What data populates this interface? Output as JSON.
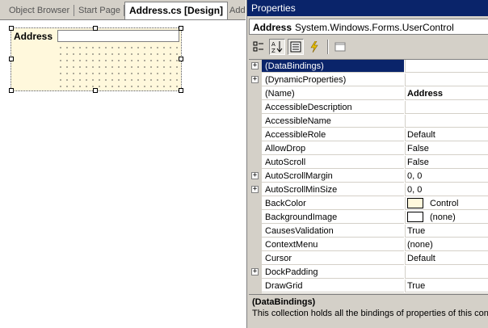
{
  "tabs": [
    {
      "label": "Object Browser"
    },
    {
      "label": "Start Page"
    },
    {
      "label": "Address.cs [Design]",
      "selected": true
    },
    {
      "label": "Addr"
    }
  ],
  "designer": {
    "control_label": "Address",
    "back_color": "#fff8dc"
  },
  "properties": {
    "title": "Properties",
    "object_name": "Address",
    "object_type": "System.Windows.Forms.UserControl",
    "rows": [
      {
        "name": "(DataBindings)",
        "value": "",
        "expandable": true,
        "selected": true
      },
      {
        "name": "(DynamicProperties)",
        "value": "",
        "expandable": true
      },
      {
        "name": "(Name)",
        "value": "Address",
        "bold": true
      },
      {
        "name": "AccessibleDescription",
        "value": ""
      },
      {
        "name": "AccessibleName",
        "value": ""
      },
      {
        "name": "AccessibleRole",
        "value": "Default"
      },
      {
        "name": "AllowDrop",
        "value": "False"
      },
      {
        "name": "AutoScroll",
        "value": "False"
      },
      {
        "name": "AutoScrollMargin",
        "value": "0, 0",
        "expandable": true
      },
      {
        "name": "AutoScrollMinSize",
        "value": "0, 0",
        "expandable": true
      },
      {
        "name": "BackColor",
        "value": "Control",
        "swatch": "#fff8dc"
      },
      {
        "name": "BackgroundImage",
        "value": "(none)",
        "swatch": "#ffffff"
      },
      {
        "name": "CausesValidation",
        "value": "True"
      },
      {
        "name": "ContextMenu",
        "value": "(none)"
      },
      {
        "name": "Cursor",
        "value": "Default"
      },
      {
        "name": "DockPadding",
        "value": "",
        "expandable": true
      },
      {
        "name": "DrawGrid",
        "value": "True"
      }
    ],
    "description": {
      "title": "(DataBindings)",
      "text": "This collection holds all the bindings of properties of this control"
    }
  },
  "colors": {
    "selection": "#0a246a",
    "chrome": "#d4d0c8"
  }
}
